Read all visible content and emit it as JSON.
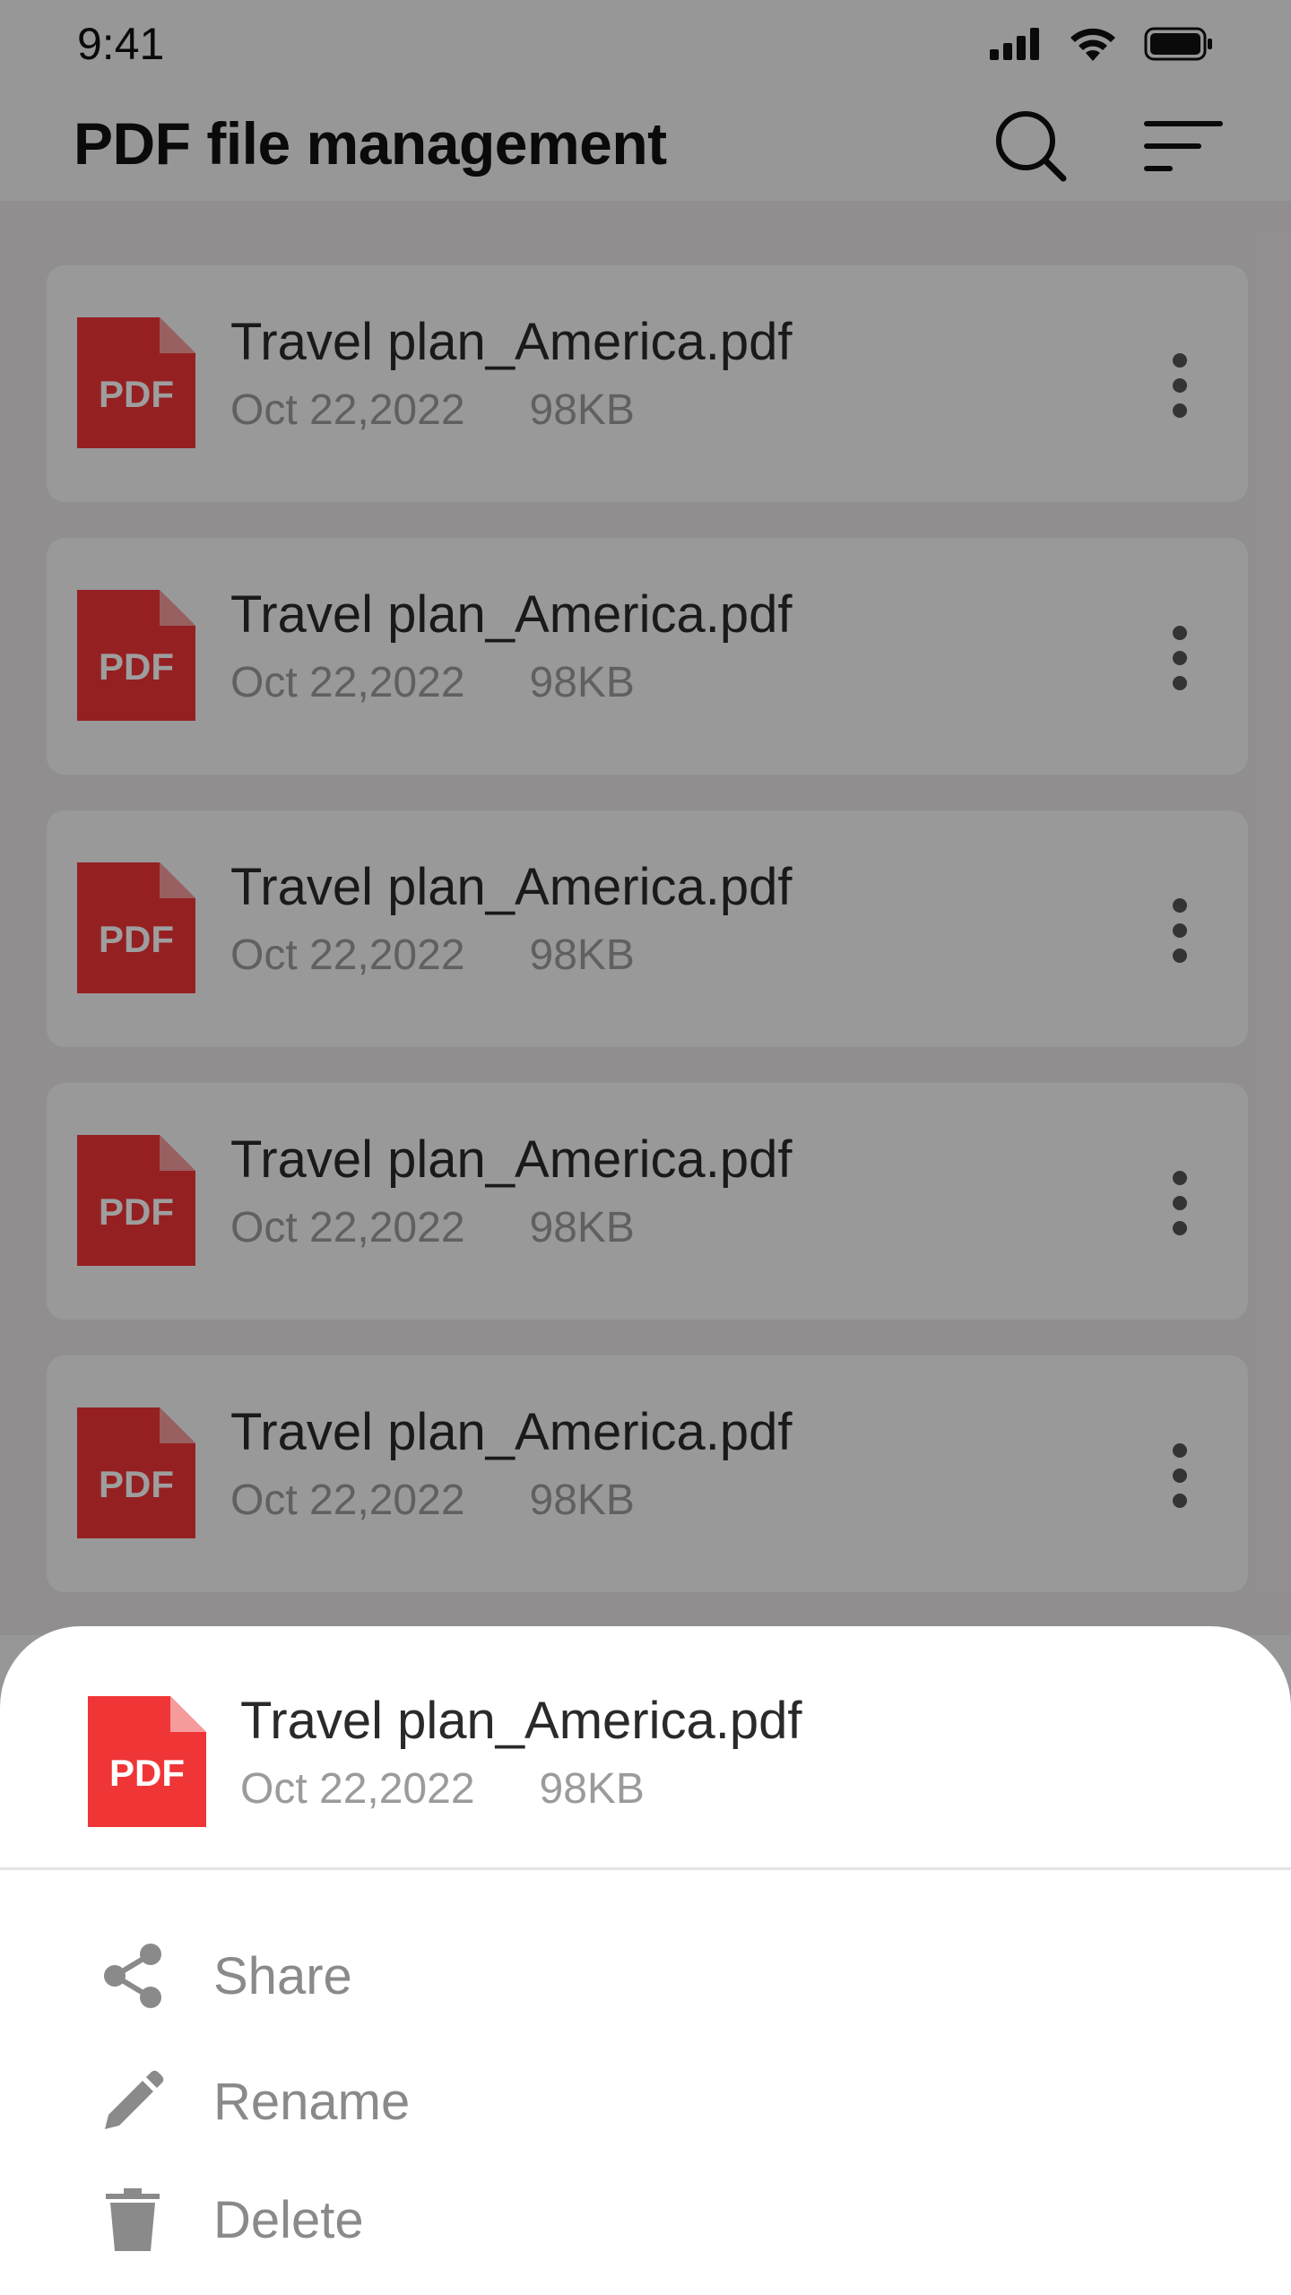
{
  "status_bar": {
    "time": "9:41"
  },
  "app_bar": {
    "title": "PDF file management"
  },
  "pdf_icon_label": "PDF",
  "files": [
    {
      "name": "Travel plan_America.pdf",
      "date": "Oct 22,2022",
      "size": "98KB"
    },
    {
      "name": "Travel plan_America.pdf",
      "date": "Oct 22,2022",
      "size": "98KB"
    },
    {
      "name": "Travel plan_America.pdf",
      "date": "Oct 22,2022",
      "size": "98KB"
    },
    {
      "name": "Travel plan_America.pdf",
      "date": "Oct 22,2022",
      "size": "98KB"
    },
    {
      "name": "Travel plan_America.pdf",
      "date": "Oct 22,2022",
      "size": "98KB"
    }
  ],
  "sheet": {
    "file": {
      "name": "Travel plan_America.pdf",
      "date": "Oct 22,2022",
      "size": "98KB"
    },
    "actions": [
      {
        "label": "Share",
        "icon": "share-icon"
      },
      {
        "label": "Rename",
        "icon": "pencil-icon"
      },
      {
        "label": "Delete",
        "icon": "trash-icon"
      }
    ]
  },
  "colors": {
    "pdf_red": "#f03537",
    "background": "#f4f4f6",
    "card": "#f7f7f9"
  }
}
